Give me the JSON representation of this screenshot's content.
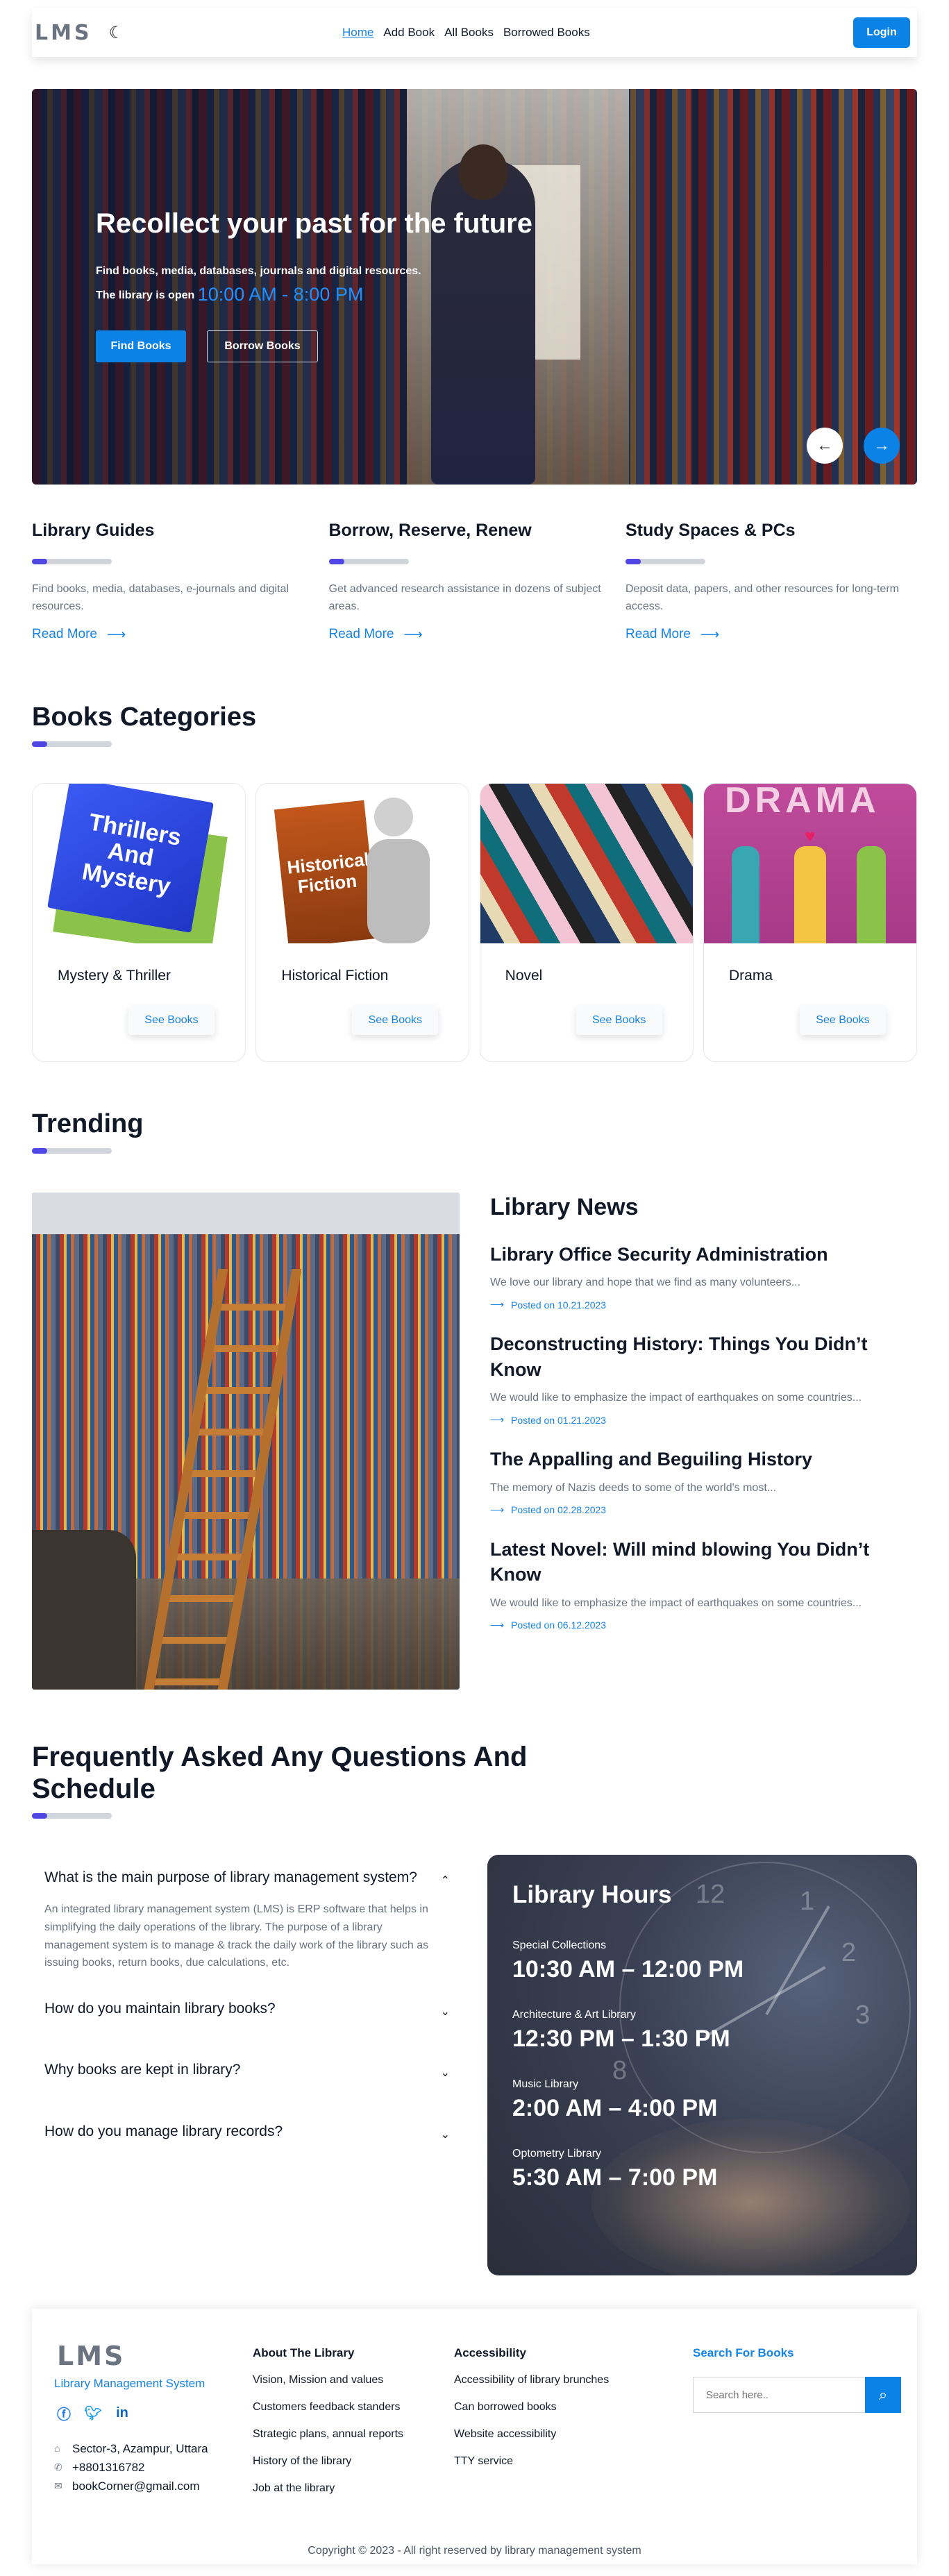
{
  "nav": {
    "logo": "LMS",
    "theme_icon": "moon-icon",
    "links": [
      "Home",
      "Add Book",
      "All Books",
      "Borrowed Books"
    ],
    "login": "Login"
  },
  "hero": {
    "title": "Recollect your past for the future",
    "subtitle": "Find books, media, databases, journals and digital resources.",
    "hours_prefix": "The library is open",
    "hours": "10:00 AM - 8:00 PM",
    "btn_find": "Find Books",
    "btn_borrow": "Borrow Books"
  },
  "info": [
    {
      "title": "Library Guides",
      "text": "Find books, media, databases, e-journals and digital resources.",
      "link": "Read More"
    },
    {
      "title": "Borrow, Reserve, Renew",
      "text": "Get advanced research assistance in dozens of subject areas.",
      "link": "Read More"
    },
    {
      "title": "Study Spaces & PCs",
      "text": "Deposit data, papers, and other resources for long-term access.",
      "link": "Read More"
    }
  ],
  "categories": {
    "title": "Books Categories",
    "items": [
      {
        "name": "Mystery & Thriller",
        "img_text": "Thrillers And Mystery",
        "btn": "See Books"
      },
      {
        "name": "Historical Fiction",
        "img_text": "Historical Fiction",
        "btn": "See Books"
      },
      {
        "name": "Novel",
        "img_text": "",
        "btn": "See Books"
      },
      {
        "name": "Drama",
        "img_text": "DRAMA",
        "btn": "See Books"
      }
    ]
  },
  "trending": {
    "title": "Trending",
    "news_title": "Library News",
    "news": [
      {
        "title": "Library Office Security Administration",
        "text": "We love our library and hope that we find as many volunteers...",
        "date": "Posted on 10.21.2023"
      },
      {
        "title": "Deconstructing History: Things You Didn’t Know",
        "text": "We would like to emphasize the impact of earthquakes on some countries...",
        "date": "Posted on 01.21.2023"
      },
      {
        "title": "The Appalling and Beguiling History",
        "text": "The memory of Nazis deeds to some of the world's most...",
        "date": "Posted on 02.28.2023"
      },
      {
        "title": "Latest Novel: Will mind blowing You Didn’t Know",
        "text": "We would like to emphasize the impact of earthquakes on some countries...",
        "date": "Posted on 06.12.2023"
      }
    ]
  },
  "faq": {
    "title": "Frequently Asked Any Questions And Schedule",
    "items": [
      {
        "q": "What is the main purpose of library management system?",
        "a": "An integrated library management system (LMS) is ERP software that helps in simplifying the daily operations of the library. The purpose of a library management system is to manage & track the daily work of the library such as issuing books, return books, due calculations, etc.",
        "open": true
      },
      {
        "q": "How do you maintain library books?",
        "a": "",
        "open": false
      },
      {
        "q": "Why books are kept in library?",
        "a": "",
        "open": false
      },
      {
        "q": "How do you manage library records?",
        "a": "",
        "open": false
      }
    ]
  },
  "hours": {
    "title": "Library Hours",
    "slots": [
      {
        "label": "Special Collections",
        "time": "10:30 AM – 12:00 PM"
      },
      {
        "label": "Architecture & Art Library",
        "time": "12:30 PM – 1:30 PM"
      },
      {
        "label": "Music Library",
        "time": "2:00 AM – 4:00 PM"
      },
      {
        "label": "Optometry Library",
        "time": "5:30 AM – 7:00 PM"
      }
    ]
  },
  "footer": {
    "logo": "LMS",
    "tagline": "Library Management System",
    "address": "Sector-3, Azampur, Uttara",
    "phone": "+8801316782",
    "email": "bookCorner@gmail.com",
    "about_title": "About The Library",
    "about_links": [
      "Vision, Mission and values",
      "Customers feedback standers",
      "Strategic plans, annual reports",
      "History of the library",
      "Job at the library"
    ],
    "access_title": "Accessibility",
    "access_links": [
      "Accessibility of library brunches",
      "Can borrowed books",
      "Website accessibility",
      "TTY service"
    ],
    "search_title": "Search For Books",
    "search_placeholder": "Search here..",
    "copyright": "Copyright © 2023 - All right reserved by library management system"
  },
  "colors": {
    "accent": "#0b82e6",
    "indicator": "#4f46e5"
  }
}
